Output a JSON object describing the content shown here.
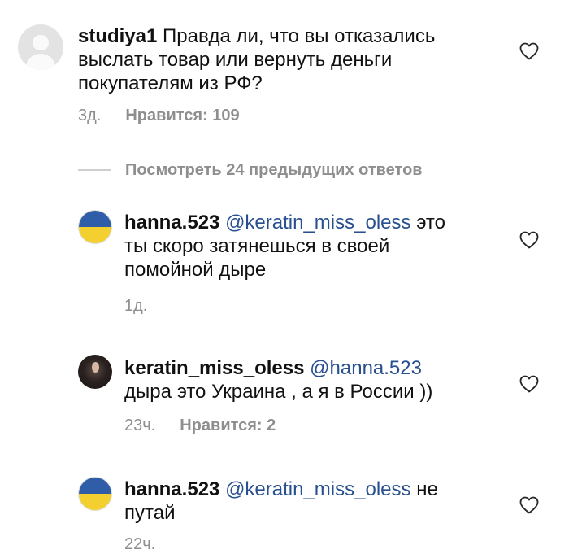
{
  "comments": [
    {
      "username": "studiya1",
      "lines": [
        "Правда ли, что вы отказались",
        "выслать товар или вернуть деньги",
        "покупателям из РФ?"
      ],
      "time": "3д.",
      "likes": "Нравится: 109",
      "avatar": "default-avatar-icon"
    },
    {
      "username": "hanna.523",
      "mention": "@keratin_miss_oless",
      "lines": [
        "это",
        "ты скоро затянешься в своей",
        "помойной дыре"
      ],
      "time": "1д.",
      "avatar": "ukraine-flag-avatar"
    },
    {
      "username": "keratin_miss_oless",
      "mention": "@hanna.523",
      "lines": [
        "дыра это Украина , а я в России ))"
      ],
      "time": "23ч.",
      "likes": "Нравится: 2",
      "avatar": "photo-avatar"
    },
    {
      "username": "hanna.523",
      "mention": "@keratin_miss_oless",
      "lines": [
        "не",
        "путай"
      ],
      "time": "22ч.",
      "avatar": "ukraine-flag-avatar"
    }
  ],
  "view_more_replies": "Посмотреть 24 предыдущих ответов",
  "colors": {
    "text": "#111111",
    "mention": "#284f8f",
    "meta": "#8e8e8e"
  },
  "icons": {
    "like": "heart-icon"
  }
}
